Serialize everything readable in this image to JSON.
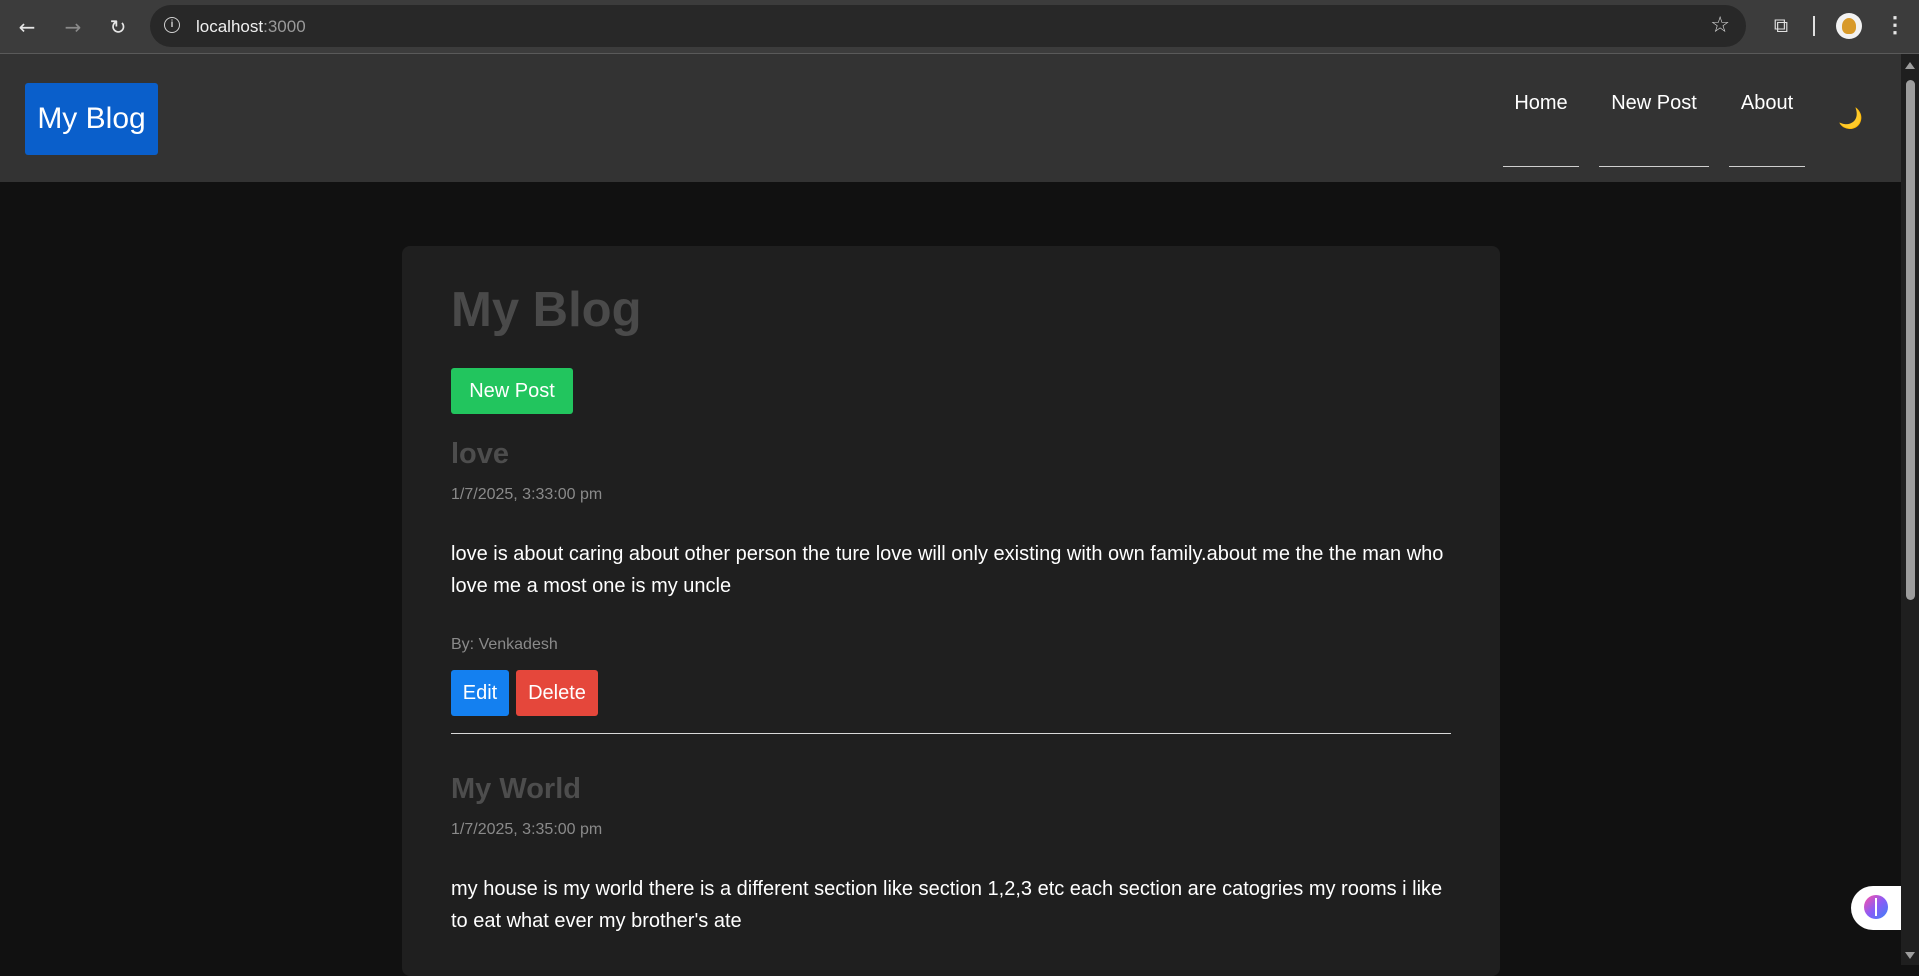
{
  "browser": {
    "back_icon": "←",
    "forward_icon": "→",
    "reload_icon": "↻",
    "url_host": "localhost",
    "url_port": ":3000",
    "star_icon": "☆",
    "extensions_icon": "⧉",
    "menu_icon": "⋮"
  },
  "header": {
    "logo": "My Blog",
    "nav": [
      {
        "label": "Home"
      },
      {
        "label": "New Post"
      },
      {
        "label": "About"
      }
    ],
    "theme_icon": "🌙"
  },
  "main": {
    "title": "My Blog",
    "new_post_label": "New Post",
    "posts": [
      {
        "title": "love",
        "date": "1/7/2025, 3:33:00 pm",
        "body": "love is about caring about other person the ture love will only existing with own family.about me the the man who love me a most one is my uncle",
        "author": "By: Venkadesh",
        "edit_label": "Edit",
        "delete_label": "Delete"
      },
      {
        "title": "My World",
        "date": "1/7/2025, 3:35:00 pm",
        "body": "my house is my world there is a different section like section 1,2,3 etc each section are catogries my rooms i like to eat what ever my brother's ate"
      }
    ]
  },
  "colors": {
    "logo_bg": "#0a5fcb",
    "new_post_bg": "#22c55e",
    "edit_bg": "#1480f0",
    "delete_bg": "#e5473b"
  }
}
